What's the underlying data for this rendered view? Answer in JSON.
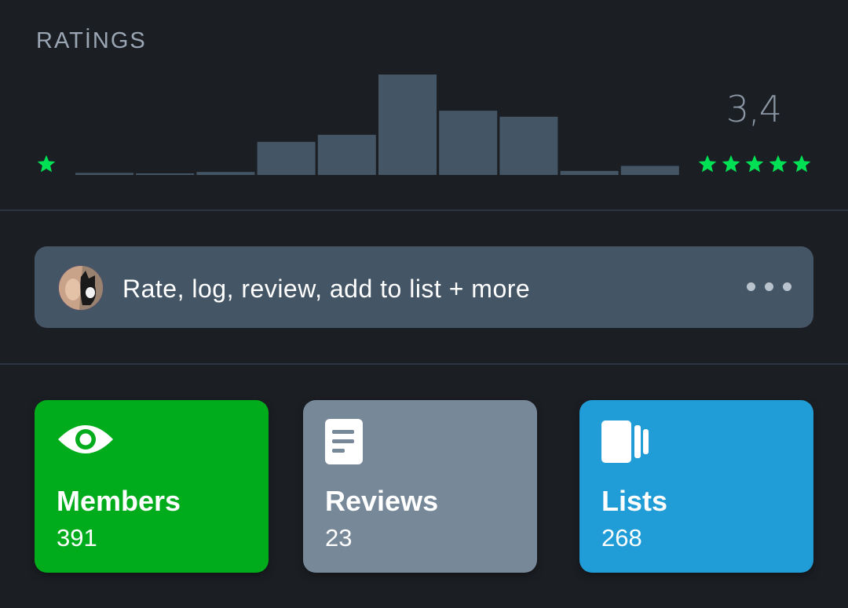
{
  "ratings": {
    "title": "RATİNGS",
    "average": "3,4",
    "histogram": [
      2,
      1,
      3,
      33,
      40,
      100,
      64,
      58,
      4,
      9
    ],
    "colors": {
      "bar": "#445566",
      "star": "#00e054"
    }
  },
  "actions": {
    "label": "Rate, log, review, add to list + more",
    "avatar_icon": "user-avatar",
    "more_icon": "more-dots-icon"
  },
  "stats": [
    {
      "label": "Members",
      "count": "391",
      "icon": "eye-icon",
      "color": "#00ac1c"
    },
    {
      "label": "Reviews",
      "count": "23",
      "icon": "document-icon",
      "color": "#778899"
    },
    {
      "label": "Lists",
      "count": "268",
      "icon": "lists-icon",
      "color": "#209cd6"
    }
  ]
}
